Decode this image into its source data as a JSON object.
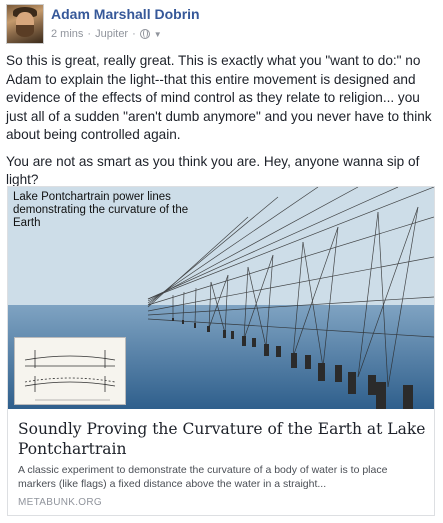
{
  "post": {
    "author": "Adam Marshall Dobrin",
    "time": "2 mins",
    "location": "Jupiter",
    "privacy_icon": "globe-icon",
    "paragraphs": [
      "So this is great, really great. This is exactly what you \"want to do:\" no Adam to explain the light--that this entire movement is designed and evidence of the effects of mind control as they relate to religion... you just all of a sudden \"aren't dumb anymore\" and you never have to think about being controlled again.",
      "You are not as smart as you think you are. Hey, anyone wanna sip of light?"
    ]
  },
  "link_card": {
    "image_caption": "Lake Pontchartrain power lines demonstrating the curvature of the Earth",
    "title": "Soundly Proving the Curvature of the Earth at Lake Pontchartrain",
    "description": "A classic experiment to demonstrate the curvature of a body of water is to place markers (like flags) a fixed distance above the water in a straight...",
    "source": "METABUNK.ORG"
  },
  "colors": {
    "name": "#365899",
    "meta": "#90949c",
    "text": "#1d2129"
  }
}
